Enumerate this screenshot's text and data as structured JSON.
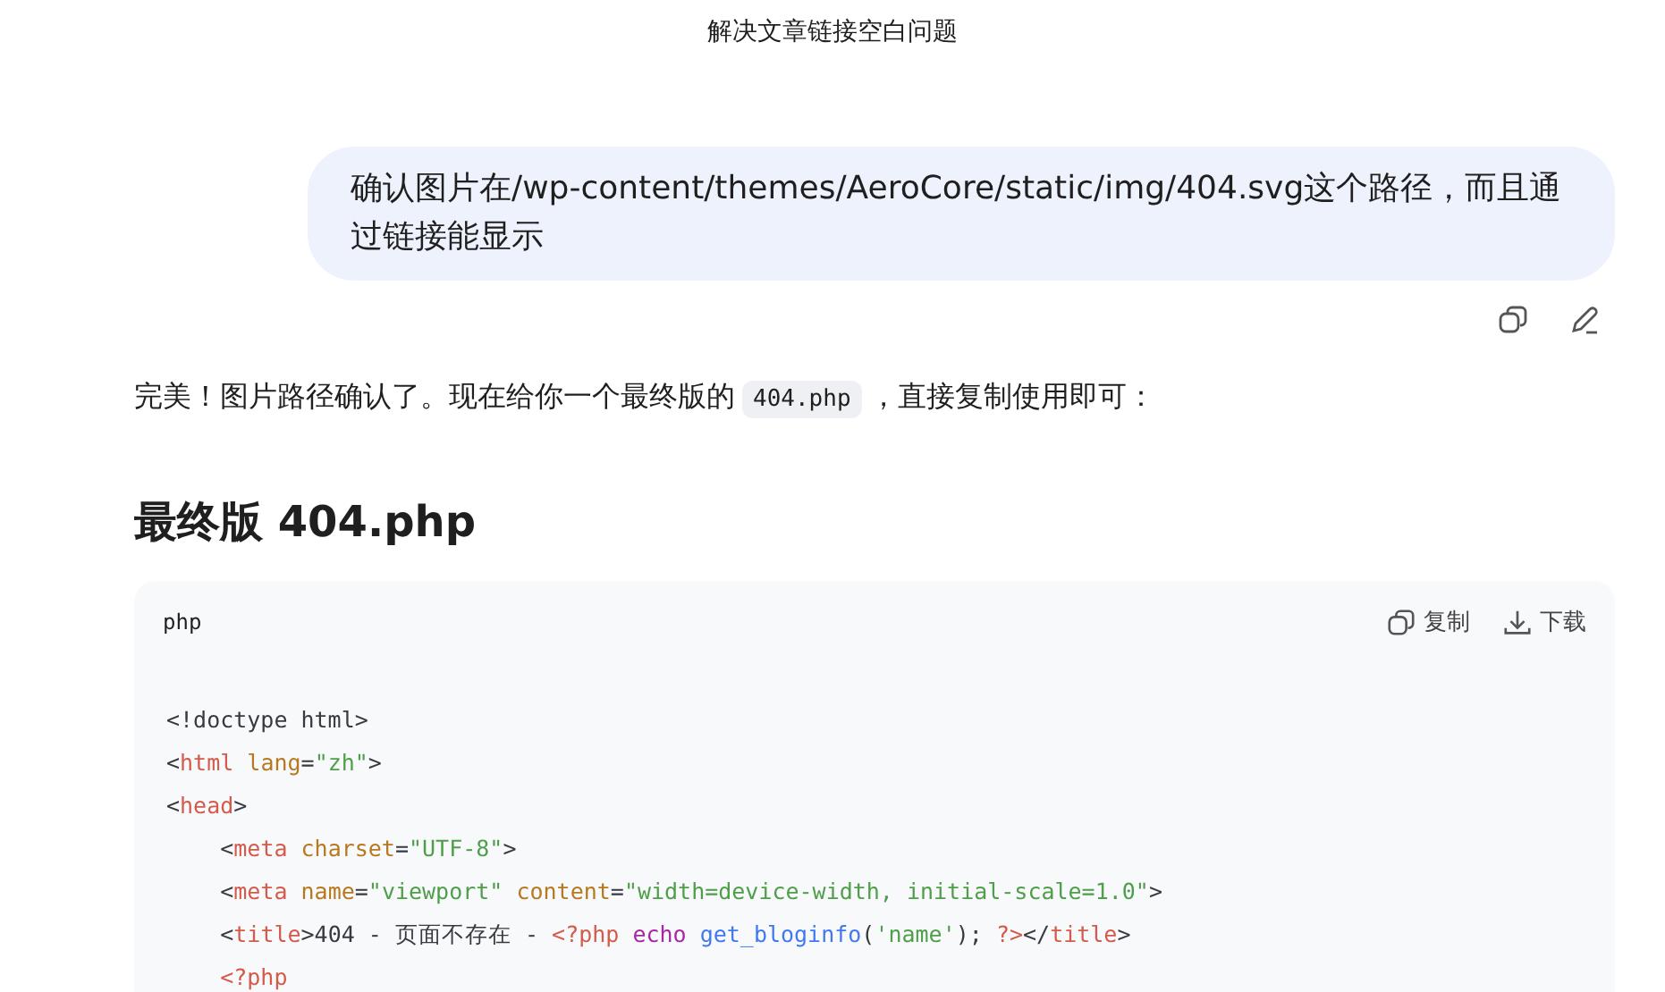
{
  "conversation_title": "解决文章链接空白问题",
  "user_message": {
    "text": "确认图片在/wp-content/themes/AeroCore/static/img/404.svg这个路径，而且通过链接能显示"
  },
  "reply": {
    "paragraph": [
      {
        "kind": "text",
        "text": "完美！图片路径确认了。现在给你一个最终版的"
      },
      {
        "kind": "code",
        "text": "404.php"
      },
      {
        "kind": "text",
        "text": "，直接复制使用即可："
      }
    ],
    "heading": "最终版 404.php",
    "code_block": {
      "language": "php",
      "copy_label": "复制",
      "download_label": "下载",
      "lines": [
        [
          {
            "kind": "plain",
            "text": "<!doctype html>"
          }
        ],
        [
          {
            "kind": "plain",
            "text": "<"
          },
          {
            "kind": "tag",
            "text": "html"
          },
          {
            "kind": "attr",
            "text": " lang"
          },
          {
            "kind": "plain",
            "text": "="
          },
          {
            "kind": "string",
            "text": "\"zh\""
          },
          {
            "kind": "plain",
            "text": ">"
          }
        ],
        [
          {
            "kind": "plain",
            "text": "<"
          },
          {
            "kind": "tag",
            "text": "head"
          },
          {
            "kind": "plain",
            "text": ">"
          }
        ],
        [
          {
            "kind": "plain",
            "text": "    <"
          },
          {
            "kind": "tag",
            "text": "meta"
          },
          {
            "kind": "attr",
            "text": " charset"
          },
          {
            "kind": "plain",
            "text": "="
          },
          {
            "kind": "string",
            "text": "\"UTF-8\""
          },
          {
            "kind": "plain",
            "text": ">"
          }
        ],
        [
          {
            "kind": "plain",
            "text": "    <"
          },
          {
            "kind": "tag",
            "text": "meta"
          },
          {
            "kind": "attr",
            "text": " name"
          },
          {
            "kind": "plain",
            "text": "="
          },
          {
            "kind": "string",
            "text": "\"viewport\""
          },
          {
            "kind": "attr",
            "text": " content"
          },
          {
            "kind": "plain",
            "text": "="
          },
          {
            "kind": "string",
            "text": "\"width=device-width, initial-scale=1.0\""
          },
          {
            "kind": "plain",
            "text": ">"
          }
        ],
        [
          {
            "kind": "plain",
            "text": "    <"
          },
          {
            "kind": "tag",
            "text": "title"
          },
          {
            "kind": "plain",
            "text": ">404 - 页面不存在 - "
          },
          {
            "kind": "tag",
            "text": "<?php"
          },
          {
            "kind": "keyword",
            "text": " echo"
          },
          {
            "kind": "function",
            "text": " get_bloginfo"
          },
          {
            "kind": "plain",
            "text": "("
          },
          {
            "kind": "string",
            "text": "'name'"
          },
          {
            "kind": "plain",
            "text": "); "
          },
          {
            "kind": "tag",
            "text": "?>"
          },
          {
            "kind": "plain",
            "text": "</"
          },
          {
            "kind": "tag",
            "text": "title"
          },
          {
            "kind": "plain",
            "text": ">"
          }
        ],
        [
          {
            "kind": "tag",
            "text": "    <?php"
          }
        ]
      ]
    }
  }
}
